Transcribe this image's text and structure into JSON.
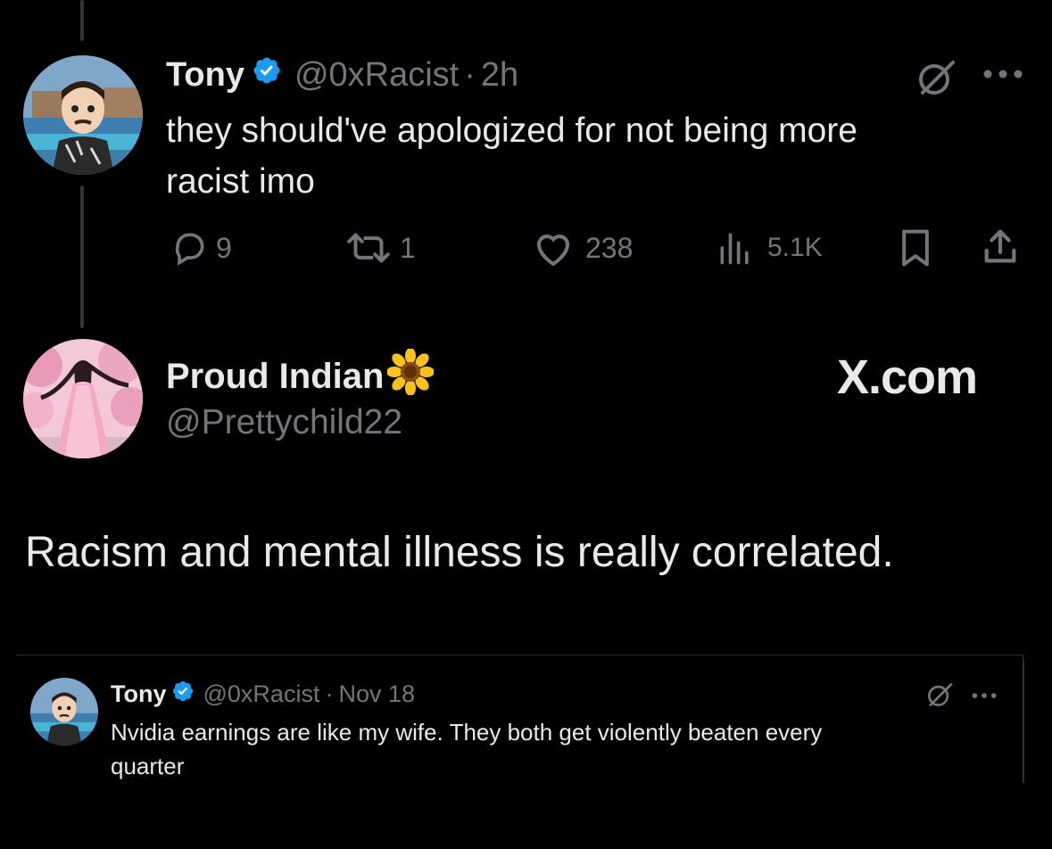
{
  "tweet": {
    "author_name": "Tony",
    "author_handle": "@0xRacist",
    "separator": "·",
    "time": "2h",
    "text_line1": "they should've apologized for not being more",
    "text_line2": "racist imo",
    "stats": {
      "replies": "9",
      "retweets": "1",
      "likes": "238",
      "views": "5.1K"
    }
  },
  "reply": {
    "author_name": "Proud Indian",
    "author_emoji": "🌻",
    "author_handle": "@Prettychild22",
    "watermark": "X.com",
    "text": "Racism and mental illness is really correlated."
  },
  "quoted": {
    "author_name": "Tony",
    "author_handle": "@0xRacist",
    "separator": "·",
    "date": "Nov 18",
    "text_line1": "Nvidia earnings are like my wife. They both get violently beaten every",
    "text_line2": "quarter"
  },
  "colors": {
    "background": "#000000",
    "text": "#e7e9ea",
    "muted": "#71767b",
    "verified": "#1d9bf0"
  },
  "icons": [
    "reply-icon",
    "retweet-icon",
    "like-icon",
    "views-icon",
    "bookmark-icon",
    "share-icon",
    "grok-icon",
    "more-icon",
    "verified-badge-icon"
  ]
}
